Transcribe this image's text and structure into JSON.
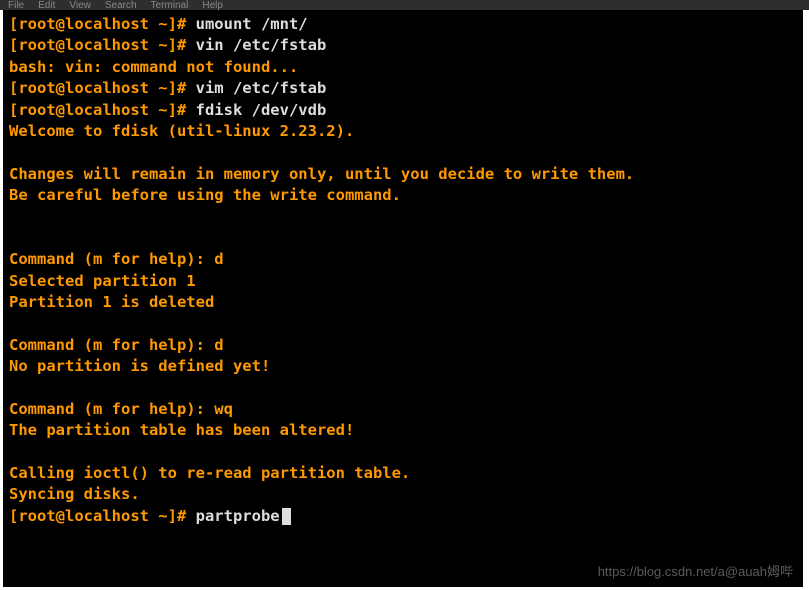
{
  "menubar": {
    "items": [
      "File",
      "Edit",
      "View",
      "Search",
      "Terminal",
      "Help"
    ]
  },
  "terminal": {
    "lines": [
      {
        "prompt": "[root@localhost ~]# ",
        "command": "umount /mnt/"
      },
      {
        "prompt": "[root@localhost ~]# ",
        "command": "vin /etc/fstab"
      },
      {
        "output": "bash: vin: command not found..."
      },
      {
        "prompt": "[root@localhost ~]# ",
        "command": "vim /etc/fstab"
      },
      {
        "prompt": "[root@localhost ~]# ",
        "command": "fdisk /dev/vdb"
      },
      {
        "output": "Welcome to fdisk (util-linux 2.23.2)."
      },
      {
        "output": ""
      },
      {
        "output": "Changes will remain in memory only, until you decide to write them."
      },
      {
        "output": "Be careful before using the write command."
      },
      {
        "output": ""
      },
      {
        "output": ""
      },
      {
        "output": "Command (m for help): d"
      },
      {
        "output": "Selected partition 1"
      },
      {
        "output": "Partition 1 is deleted"
      },
      {
        "output": ""
      },
      {
        "output": "Command (m for help): d"
      },
      {
        "output": "No partition is defined yet!"
      },
      {
        "output": ""
      },
      {
        "output": "Command (m for help): wq"
      },
      {
        "output": "The partition table has been altered!"
      },
      {
        "output": ""
      },
      {
        "output": "Calling ioctl() to re-read partition table."
      },
      {
        "output": "Syncing disks."
      },
      {
        "prompt": "[root@localhost ~]# ",
        "command": "partprobe",
        "cursor": true
      }
    ]
  },
  "watermark": "https://blog.csdn.net/a@auah姆哔"
}
